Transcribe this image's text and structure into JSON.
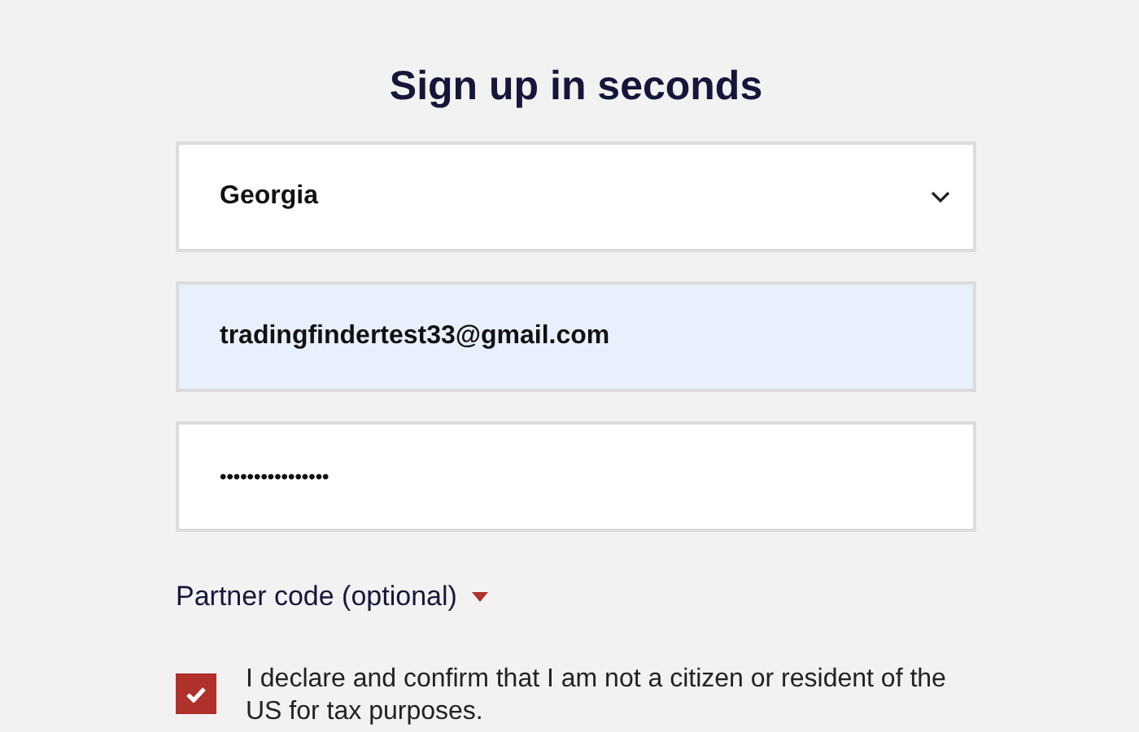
{
  "title": "Sign up in seconds",
  "country": {
    "value": "Georgia"
  },
  "email": {
    "value": "tradingfindertest33@gmail.com",
    "autofilled": true
  },
  "password": {
    "value": "••••••••••••••••"
  },
  "partner_code": {
    "label": "Partner code (optional)",
    "expanded": false
  },
  "declaration": {
    "text": "I declare and confirm that I am not a citizen or resident of the US for tax purposes.",
    "checked": true
  }
}
